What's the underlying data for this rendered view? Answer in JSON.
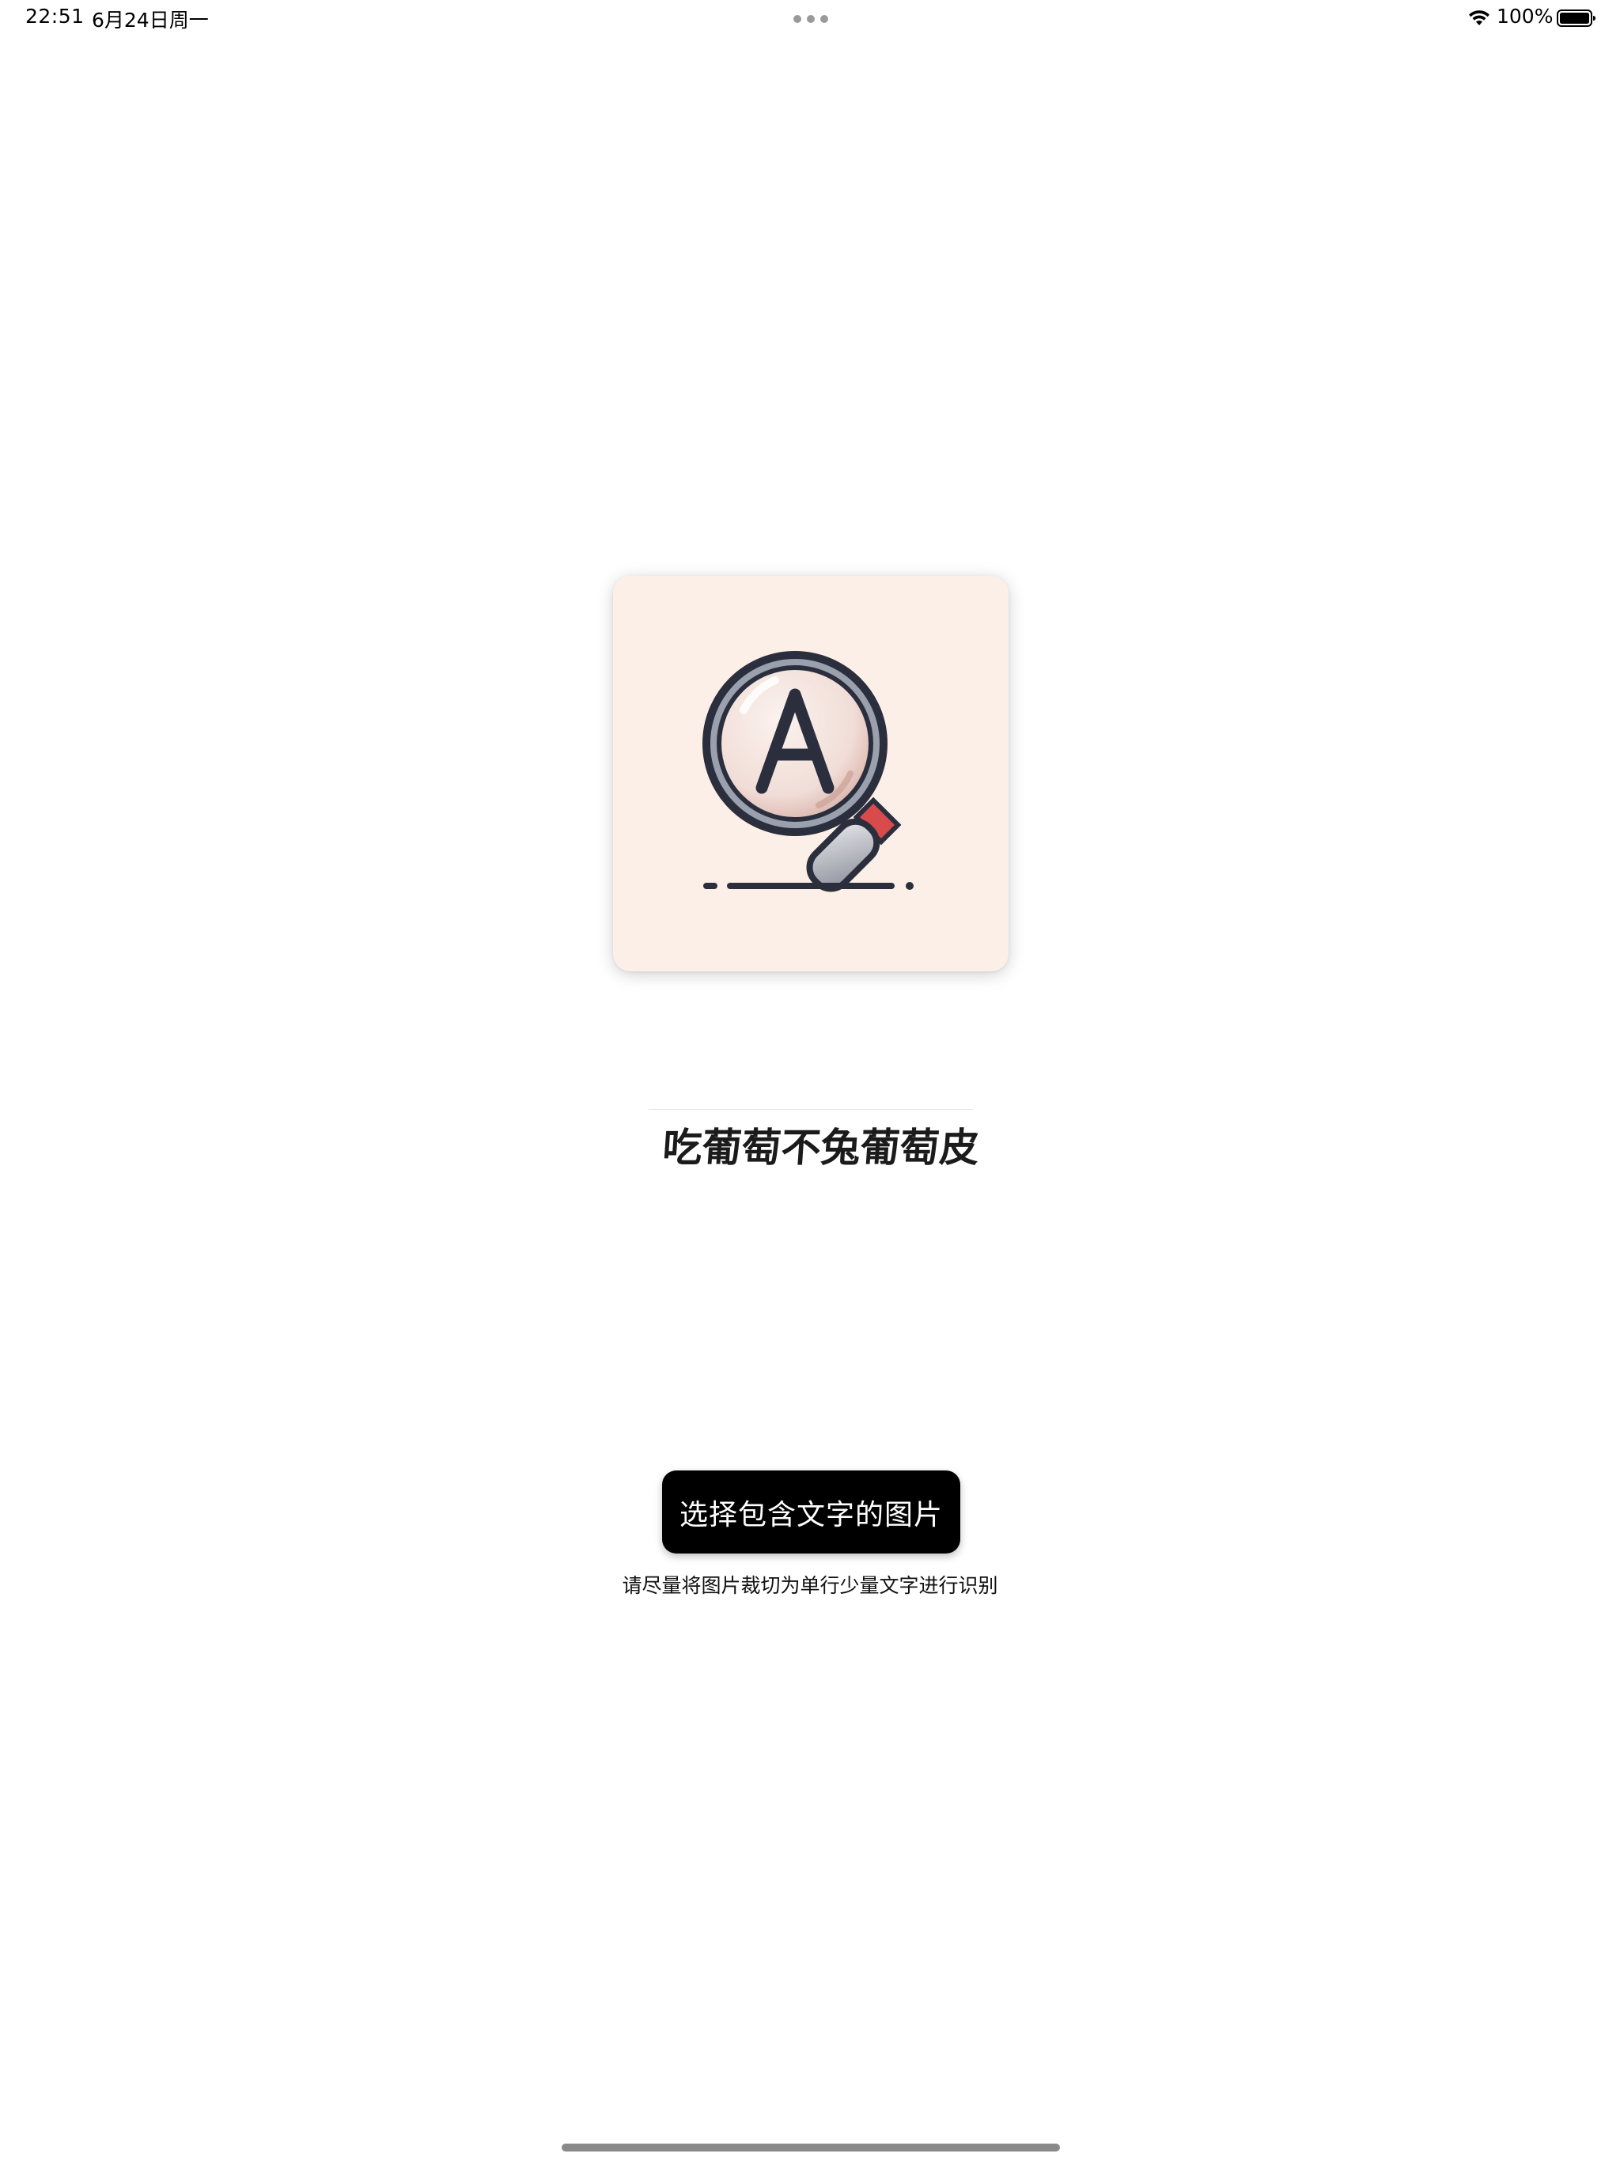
{
  "status_bar": {
    "time": "22:51",
    "date": "6月24日周一",
    "battery": "100%",
    "icons": [
      "wifi-icon",
      "battery-icon",
      "multitask-dots-icon"
    ]
  },
  "app_icon": {
    "letter": "A",
    "background_color": "#fcefe7",
    "icon": "magnifying-glass-icon"
  },
  "sample_image": {
    "text": "吃葡萄不兔葡萄皮"
  },
  "main": {
    "select_button_label": "选择包含文字的图片",
    "hint": "请尽量将图片裁切为单行少量文字进行识别"
  }
}
